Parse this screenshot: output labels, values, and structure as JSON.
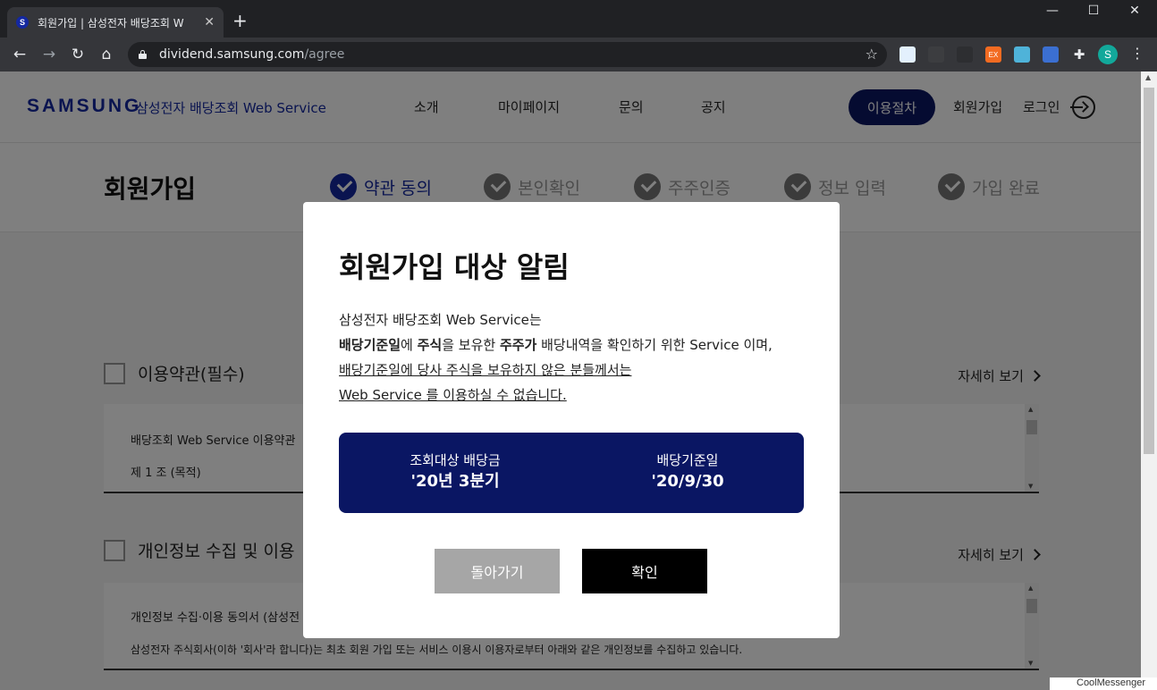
{
  "browser": {
    "tab_title": "회원가입 | 삼성전자 배당조회 W",
    "tab_favicon": "S",
    "url_host": "dividend.samsung.com",
    "url_path": "/agree",
    "profile_initial": "S",
    "ext_badge": "EX"
  },
  "header": {
    "logo": "SAMSUNG",
    "logo_sub": "삼성전자 배당조회 Web Service",
    "nav": [
      "소개",
      "마이페이지",
      "문의",
      "공지"
    ],
    "pill": "이용절차",
    "signup": "회원가입",
    "login": "로그인"
  },
  "steps": {
    "title": "회원가입",
    "items": [
      "약관 동의",
      "본인확인",
      "주주인증",
      "정보 입력",
      "가입 완료"
    ],
    "active_index": 0
  },
  "sections": [
    {
      "title": "이용약관(필수)",
      "more": "자세히 보기",
      "line1": "배당조회 Web Service 이용약관",
      "line2": "제 1 조 (목적)"
    },
    {
      "title": "개인정보 수집 및 이용",
      "more": "자세히 보기",
      "line1": "개인정보 수집·이용 동의서 (삼성전",
      "line2": "삼성전자 주식회사(이하 '회사'라 합니다)는 최초 회원 가입 또는 서비스 이용시 이용자로부터 아래와 같은 개인정보를 수집하고 있습니다."
    }
  ],
  "modal": {
    "title": "회원가입 대상 알림",
    "line1": "삼성전자 배당조회 Web Service는",
    "line2_b1": "배당기준일",
    "line2_t1": "에 ",
    "line2_b2": "주식",
    "line2_t2": "을 보유한 ",
    "line2_b3": "주주가",
    "line2_t3": " 배당내역을 확인하기 위한 Service 이며,",
    "line3": "배당기준일에 당사 주식을 보유하지 않은 분들께서는",
    "line4": "Web Service 를 이용하실 수 없습니다.",
    "info": [
      {
        "label": "조회대상 배당금",
        "value": "'20년 3분기"
      },
      {
        "label": "배당기준일",
        "value": "'20/9/30"
      }
    ],
    "back_button": "돌아가기",
    "ok_button": "확인"
  },
  "taskbar_hint": "CoolMessenger",
  "colors": {
    "brand": "#1428a0",
    "navy": "#0a1663"
  }
}
